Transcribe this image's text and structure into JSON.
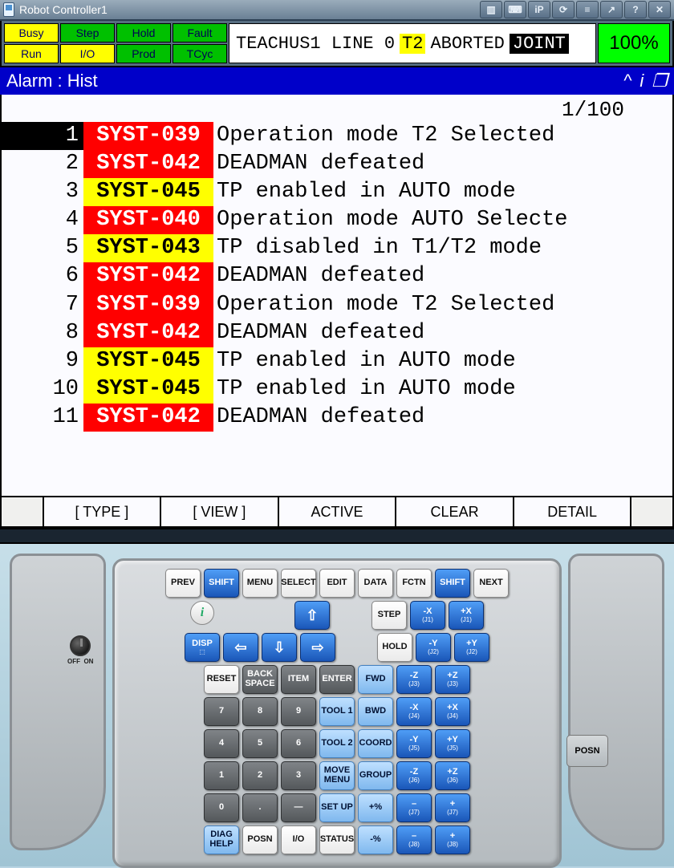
{
  "window": {
    "title": "Robot Controller1"
  },
  "status_cells": {
    "r1": [
      "Busy",
      "Step",
      "Hold",
      "Fault"
    ],
    "r2": [
      "Run",
      "I/O",
      "Prod",
      "TCyc"
    ]
  },
  "status_cell_style": {
    "r1": [
      "yellow",
      "green",
      "green",
      "green"
    ],
    "r2": [
      "yellow",
      "yellow",
      "green",
      "green"
    ]
  },
  "status_line": {
    "pre": "TEACHUS1 LINE 0",
    "t2": "T2",
    "state": "ABORTED",
    "joint": "JOINT",
    "pct": "100%"
  },
  "screen": {
    "title": "Alarm : Hist",
    "counter": "1/100"
  },
  "alarms": [
    {
      "n": "1",
      "code": "SYST-039",
      "sev": "red",
      "sel": true,
      "msg": "Operation mode T2 Selected"
    },
    {
      "n": "2",
      "code": "SYST-042",
      "sev": "red",
      "sel": false,
      "msg": "DEADMAN defeated"
    },
    {
      "n": "3",
      "code": "SYST-045",
      "sev": "yellow",
      "sel": false,
      "msg": "TP enabled in AUTO mode"
    },
    {
      "n": "4",
      "code": "SYST-040",
      "sev": "red",
      "sel": false,
      "msg": "Operation mode AUTO Selecte"
    },
    {
      "n": "5",
      "code": "SYST-043",
      "sev": "yellow",
      "sel": false,
      "msg": "TP disabled in T1/T2 mode"
    },
    {
      "n": "6",
      "code": "SYST-042",
      "sev": "red",
      "sel": false,
      "msg": "DEADMAN defeated"
    },
    {
      "n": "7",
      "code": "SYST-039",
      "sev": "red",
      "sel": false,
      "msg": "Operation mode T2 Selected"
    },
    {
      "n": "8",
      "code": "SYST-042",
      "sev": "red",
      "sel": false,
      "msg": "DEADMAN defeated"
    },
    {
      "n": "9",
      "code": "SYST-045",
      "sev": "yellow",
      "sel": false,
      "msg": "TP enabled in AUTO mode"
    },
    {
      "n": "10",
      "code": "SYST-045",
      "sev": "yellow",
      "sel": false,
      "msg": "TP enabled in AUTO mode"
    },
    {
      "n": "11",
      "code": "SYST-042",
      "sev": "red",
      "sel": false,
      "msg": "DEADMAN defeated"
    }
  ],
  "fkeys": [
    "",
    "[ TYPE ]",
    "[ VIEW ]",
    "ACTIVE",
    "CLEAR",
    "DETAIL",
    ""
  ],
  "keyboard": {
    "row1": [
      {
        "l": "PREV",
        "c": "white"
      },
      {
        "l": "SHIFT",
        "c": "blue"
      },
      {
        "l": "MENU",
        "c": "white"
      },
      {
        "l": "SELECT",
        "c": "white"
      },
      {
        "l": "EDIT",
        "c": "white"
      },
      {
        "l": "DATA",
        "c": "white"
      },
      {
        "l": "FCTN",
        "c": "white"
      },
      {
        "l": "SHIFT",
        "c": "blue"
      },
      {
        "l": "NEXT",
        "c": "white"
      }
    ],
    "row2": [
      "i",
      "",
      "",
      "⇧",
      "",
      "STEP",
      "-X",
      "(J1)",
      "+X",
      "(J1)"
    ],
    "row3": [
      "DISP",
      "⬚",
      "⇦",
      "⇩",
      "⇨",
      "HOLD",
      "-Y",
      "(J2)",
      "+Y",
      "(J2)"
    ],
    "row4": [
      "RESET",
      "BACK SPACE",
      "ITEM",
      "ENTER",
      "FWD",
      "-Z",
      "(J3)",
      "+Z",
      "(J3)"
    ],
    "row5": [
      "7",
      "8",
      "9",
      "TOOL 1",
      "BWD",
      "-X",
      "(J4)",
      "+X",
      "(J4)"
    ],
    "row6": [
      "4",
      "5",
      "6",
      "TOOL 2",
      "COORD",
      "-Y",
      "(J5)",
      "+Y",
      "(J5)"
    ],
    "row7": [
      "1",
      "2",
      "3",
      "MOVE MENU",
      "GROUP",
      "-Z",
      "(J6)",
      "+Z",
      "(J6)"
    ],
    "row8": [
      "0",
      ".",
      "—",
      "SET UP",
      "+%",
      "–",
      "(J7)",
      "+",
      "(J7)"
    ],
    "row9": [
      "DIAG HELP",
      "POSN",
      "I/O",
      "STATUS",
      "-%",
      "–",
      "(J8)",
      "+",
      "(J8)"
    ],
    "posn": "POSN",
    "off": "OFF",
    "on": "ON"
  }
}
